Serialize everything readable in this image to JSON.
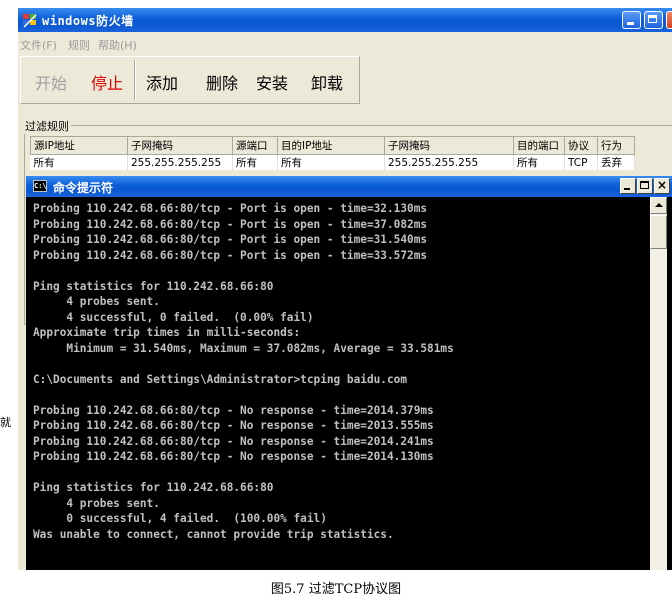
{
  "firewall_window": {
    "title": "windows防火墙",
    "menu": [
      "文件(F)",
      "规则",
      "帮助(H)"
    ],
    "toolbar": [
      "开始",
      "停止",
      "添加",
      "删除",
      "安装",
      "卸载"
    ],
    "rules_group_label": "过滤规则",
    "rules_table": {
      "headers": [
        "源IP地址",
        "子网掩码",
        "源端口",
        "目的IP地址",
        "子网掩码",
        "目的端口",
        "协议",
        "行为"
      ],
      "rows": [
        [
          "所有",
          "255.255.255.255",
          "所有",
          "所有",
          "255.255.255.255",
          "所有",
          "TCP",
          "丢弃"
        ]
      ]
    },
    "side_glyph": "就"
  },
  "cmd_window": {
    "title": "命令提示符",
    "icon_text": "C:\\",
    "lines": [
      "Probing 110.242.68.66:80/tcp - Port is open - time=32.130ms",
      "Probing 110.242.68.66:80/tcp - Port is open - time=37.082ms",
      "Probing 110.242.68.66:80/tcp - Port is open - time=31.540ms",
      "Probing 110.242.68.66:80/tcp - Port is open - time=33.572ms",
      "",
      "Ping statistics for 110.242.68.66:80",
      "     4 probes sent.",
      "     4 successful, 0 failed.  (0.00% fail)",
      "Approximate trip times in milli-seconds:",
      "     Minimum = 31.540ms, Maximum = 37.082ms, Average = 33.581ms",
      "",
      "C:\\Documents and Settings\\Administrator>tcping baidu.com",
      "",
      "Probing 110.242.68.66:80/tcp - No response - time=2014.379ms",
      "Probing 110.242.68.66:80/tcp - No response - time=2013.555ms",
      "Probing 110.242.68.66:80/tcp - No response - time=2014.241ms",
      "Probing 110.242.68.66:80/tcp - No response - time=2014.130ms",
      "",
      "Ping statistics for 110.242.68.66:80",
      "     4 probes sent.",
      "     0 successful, 4 failed.  (100.00% fail)",
      "Was unable to connect, cannot provide trip statistics."
    ]
  },
  "caption": "图5.7 过滤TCP协议图"
}
